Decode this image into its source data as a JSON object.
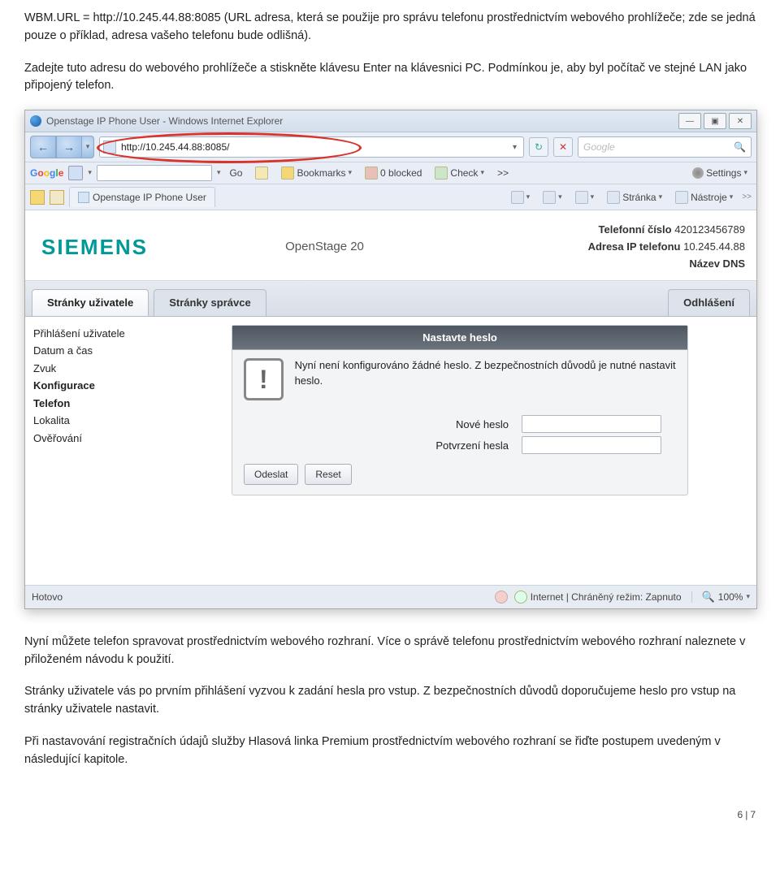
{
  "doc": {
    "para1_pre": "WBM.URL = http://10.245.44.88:8085 (URL adresa, která se použije pro správu telefonu prostřednictvím webového prohlížeče; zde se jedná pouze o příklad, adresa vašeho telefonu bude odlišná).",
    "para2a": "Zadejte tuto adresu do webového prohlížeče a stiskněte klávesu ",
    "para2_key": "Enter",
    "para2b": " na klávesnici PC. Podmínkou je, aby byl počítač ve stejné LAN jako připojený telefon.",
    "para3": "Nyní můžete telefon spravovat prostřednictvím webového rozhraní. Více o správě telefonu prostřednictvím webového rozhraní naleznete v přiloženém návodu k použití.",
    "para4": "Stránky uživatele vás po prvním přihlášení vyzvou k zadání hesla pro vstup. Z bezpečnostních důvodů doporučujeme heslo pro vstup na stránky uživatele nastavit.",
    "para5": "Při nastavování registračních údajů služby Hlasová linka Premium prostřednictvím webového rozhraní se řiďte postupem uvedeným v následující kapitole.",
    "page_left": "6",
    "page_right": "7"
  },
  "browser": {
    "title": "Openstage IP Phone User - Windows Internet Explorer",
    "url": "http://10.245.44.88:8085/",
    "search_placeholder": "Google",
    "google_toolbar": {
      "go": "Go",
      "bookmarks": "Bookmarks",
      "blocked": "0 blocked",
      "check": "Check",
      "more": ">>",
      "settings": "Settings"
    },
    "tab": "Openstage IP Phone User",
    "ribbon": {
      "stranka": "Stránka",
      "nastroje": "Nástroje",
      "more": ">>"
    },
    "status": {
      "hotovo": "Hotovo",
      "zone": "Internet | Chráněný režim: Zapnuto",
      "zoom": "100%"
    }
  },
  "page": {
    "brand": "SIEMENS",
    "product": "OpenStage 20",
    "info": {
      "tel_label": "Telefonní číslo",
      "tel_value": "420123456789",
      "ip_label": "Adresa IP telefonu",
      "ip_value": "10.245.44.88",
      "dns_label": "Název DNS",
      "dns_value": ""
    },
    "tabs": {
      "user": "Stránky uživatele",
      "admin": "Stránky správce",
      "logout": "Odhlášení"
    },
    "nav": [
      "Přihlášení uživatele",
      "Datum a čas",
      "Zvuk",
      "Konfigurace",
      "Telefon",
      "Lokalita",
      "Ověřování"
    ],
    "dialog": {
      "title": "Nastavte heslo",
      "msg": "Nyní není konfigurováno žádné heslo. Z bezpečnostních důvodů je nutné nastavit heslo.",
      "field1": "Nové heslo",
      "field2": "Potvrzení hesla",
      "submit": "Odeslat",
      "reset": "Reset"
    }
  }
}
